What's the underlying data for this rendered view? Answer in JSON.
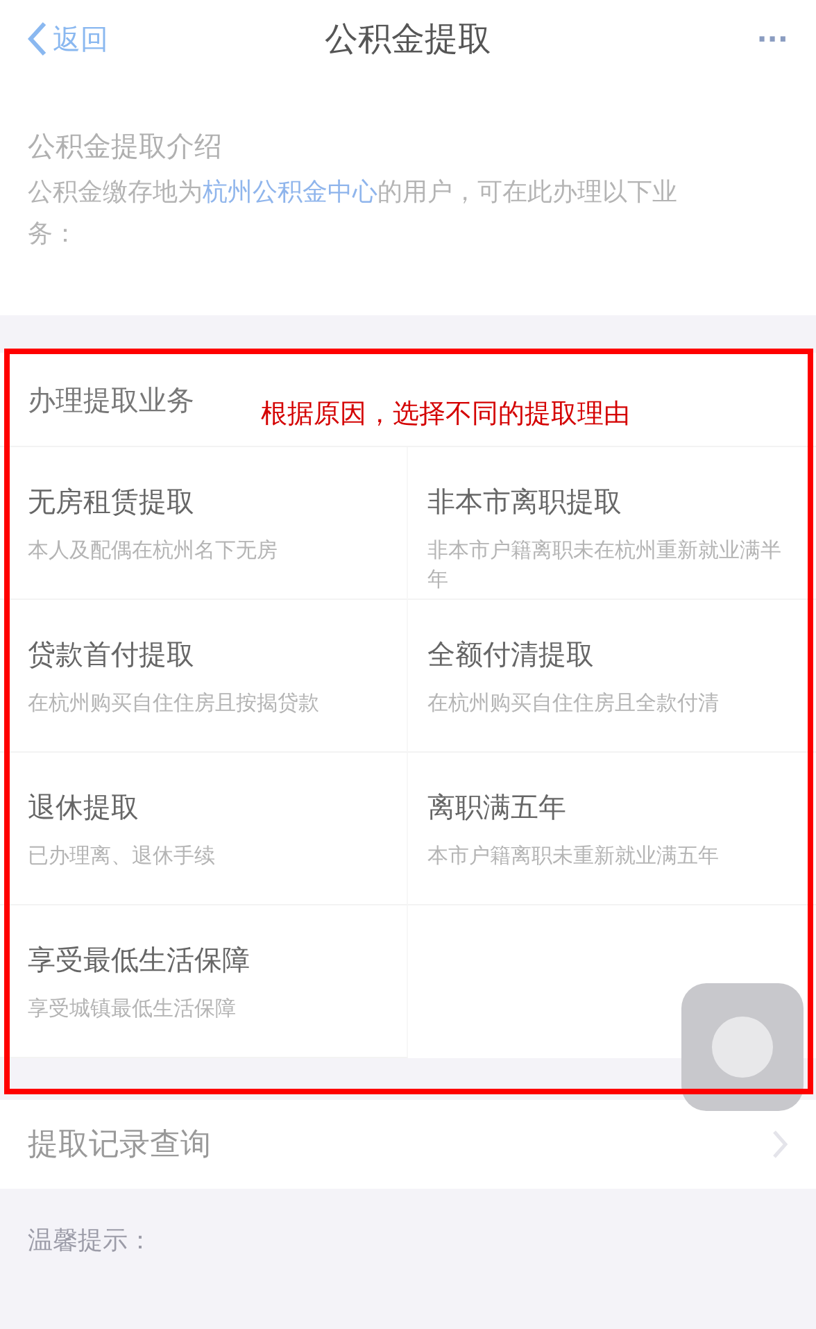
{
  "nav_bar": {
    "back": "返回",
    "title": "公积金提取",
    "more": "···"
  },
  "intro": {
    "title": "公积金提取介绍",
    "text": "公积金缴存地为**杭州公积金中心**的用户，可在此办理以下业务："
  },
  "business": {
    "title": "办理提取业务",
    "items": [
      {
        "title": "无房租赁提取",
        "description": "本人及配偶在杭州名下无房"
      },
      {
        "title": "非本市离职提取",
        "description": "非本市户籍离职未在杭州重新就业满半年"
      },
      {
        "title": "贷款首付提取",
        "description": "在杭州购买自住住房且按揭贷款"
      },
      {
        "title": "全额付清提取",
        "description": "在杭州购买自住住房且全款付清"
      },
      {
        "title": "退休提取",
        "description": "已办理离、退休手续"
      },
      {
        "title": "离职满五年",
        "description": "本市户籍离职未重新就业满五年"
      },
      {
        "title": "享受最低生活保障",
        "description": "享受城镇最低生活保障"
      }
    ]
  },
  "records": {
    "label": "提取记录查询"
  },
  "tips": {
    "title": "温馨提示："
  },
  "annotation": {
    "text": "根据原因，选择不同的提取理由"
  }
}
